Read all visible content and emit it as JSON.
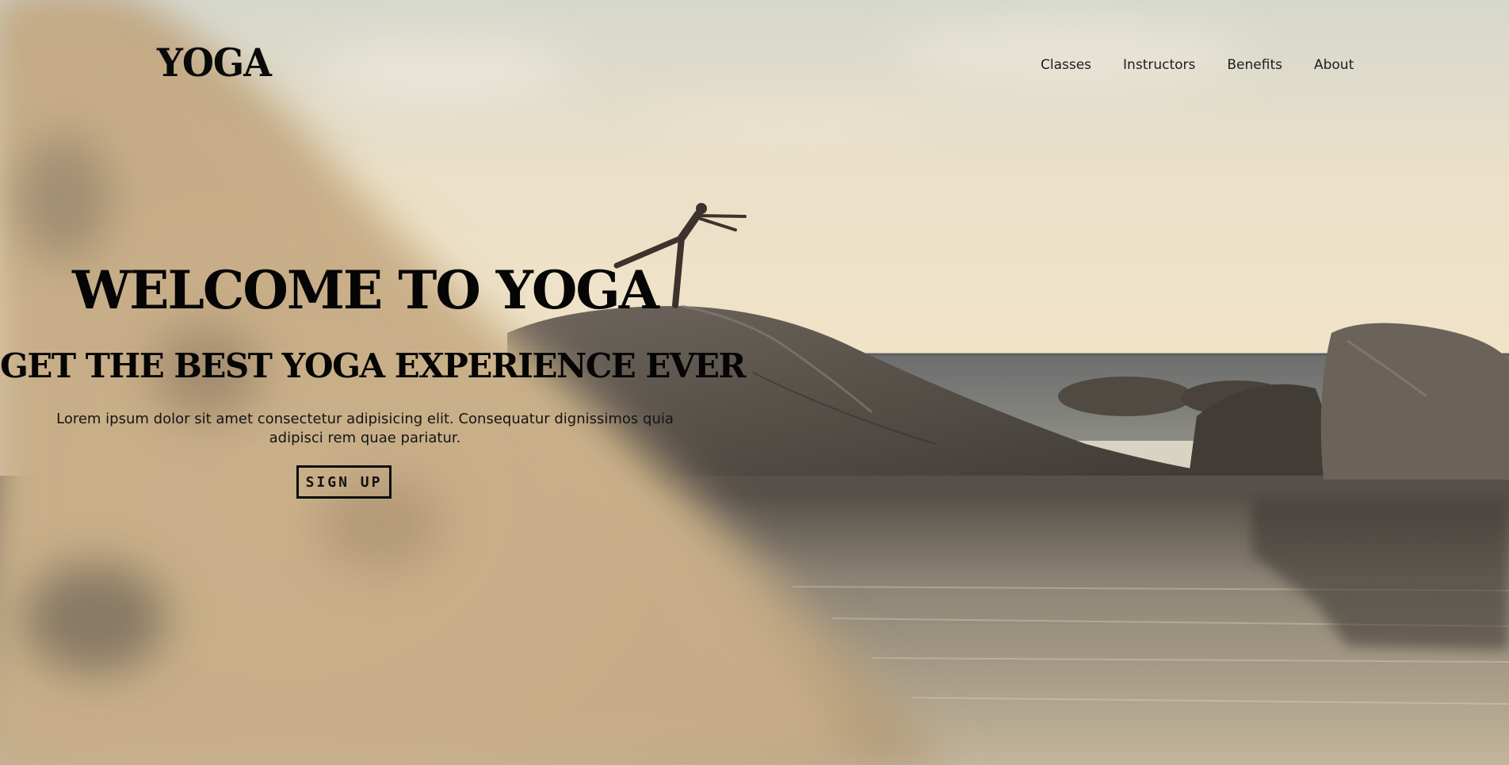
{
  "brand": {
    "logo": "YOGA"
  },
  "nav": {
    "items": [
      {
        "label": "Classes"
      },
      {
        "label": "Instructors"
      },
      {
        "label": "Benefits"
      },
      {
        "label": "About"
      }
    ]
  },
  "hero": {
    "title": "WELCOME TO YOGA",
    "subtitle": "GET THE BEST YOGA EXPERIENCE EVER",
    "description": "Lorem ipsum dolor sit amet consectetur adipisicing elit. Consequatur dignissimos quia adipisci rem quae pariatur.",
    "cta_label": "SIGN UP"
  },
  "colors": {
    "text": "#050505",
    "sky": "#e6dcc4",
    "rock": "#5a524a",
    "water": "#8f8778",
    "sand_blur": "#cdb48d"
  }
}
